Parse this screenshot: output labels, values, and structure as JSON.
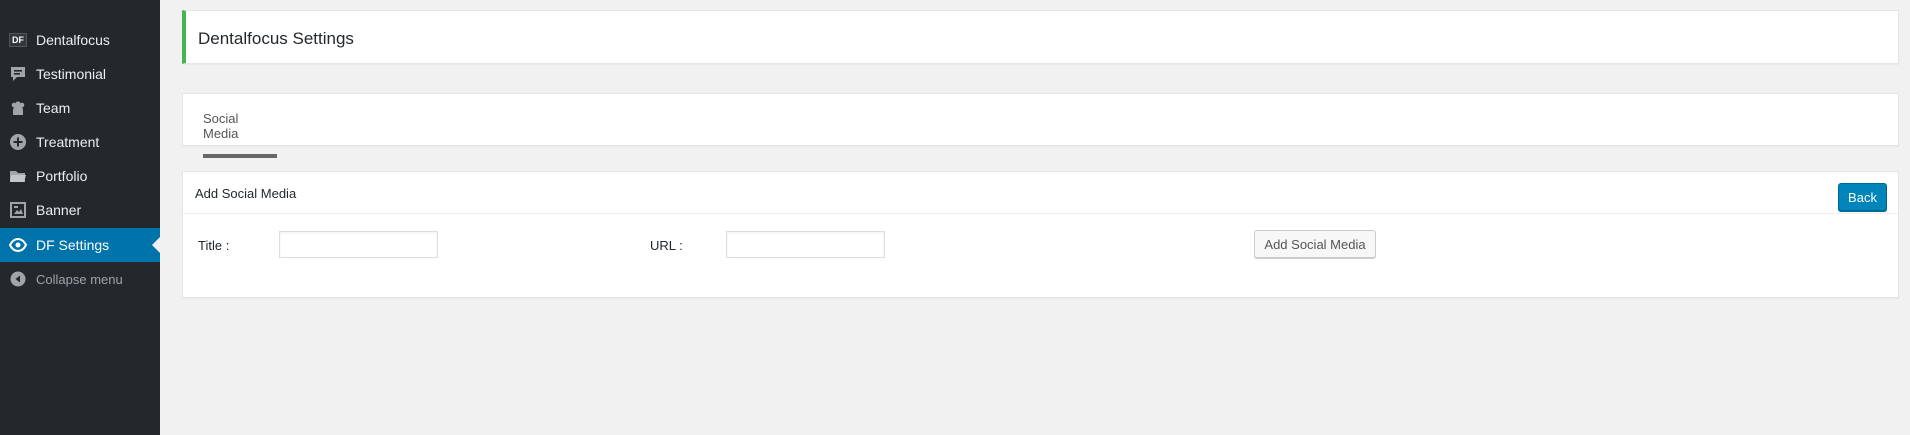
{
  "sidebar": {
    "items": [
      {
        "label": "Dentalfocus",
        "icon": "df-logo-icon"
      },
      {
        "label": "Testimonial",
        "icon": "comment-icon"
      },
      {
        "label": "Team",
        "icon": "groups-icon"
      },
      {
        "label": "Treatment",
        "icon": "plus-circle-icon"
      },
      {
        "label": "Portfolio",
        "icon": "folder-icon"
      },
      {
        "label": "Banner",
        "icon": "gallery-icon"
      },
      {
        "label": "DF Settings",
        "icon": "visibility-icon"
      },
      {
        "label": "Collapse menu",
        "icon": "collapse-icon"
      }
    ],
    "active_index": 6,
    "df_badge": "DF"
  },
  "page": {
    "title": "Dentalfocus Settings"
  },
  "tabs": [
    {
      "label": "Social Media",
      "active": true
    }
  ],
  "form": {
    "heading": "Add Social Media",
    "back_label": "Back",
    "title_label": "Title :",
    "title_value": "",
    "url_label": "URL :",
    "url_value": "",
    "submit_label": "Add Social Media"
  },
  "colors": {
    "sidebar_bg": "#23282d",
    "active_bg": "#0073aa",
    "notice_border": "#46b450",
    "primary_button": "#0085ba"
  }
}
